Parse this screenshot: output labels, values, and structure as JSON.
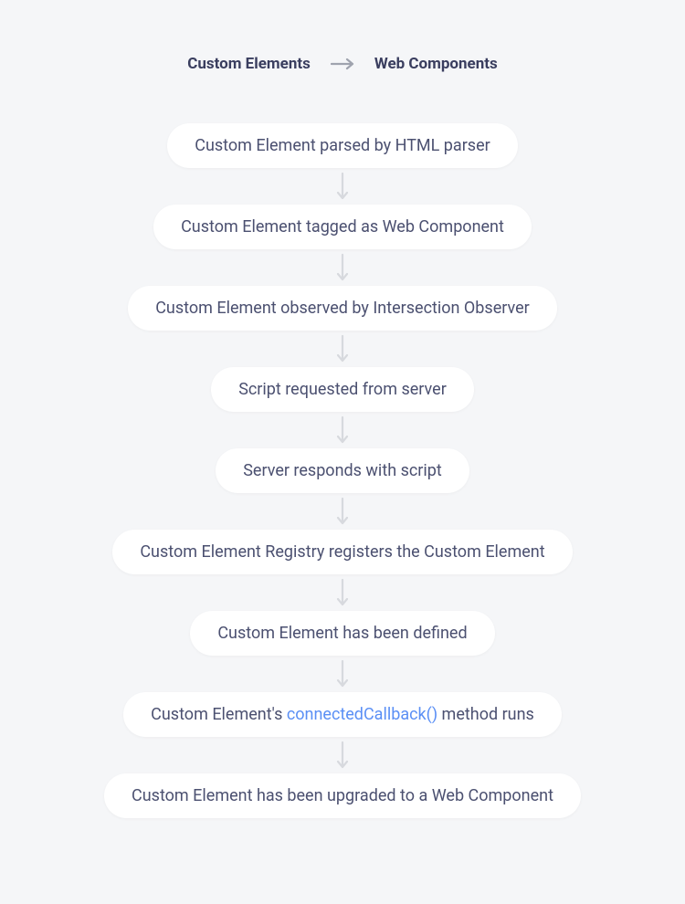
{
  "header": {
    "left_label": "Custom Elements",
    "right_label": "Web Components"
  },
  "steps": [
    {
      "text": "Custom Element parsed by HTML parser"
    },
    {
      "text": "Custom Element tagged as Web Component"
    },
    {
      "text": "Custom Element observed by Intersection Observer"
    },
    {
      "text": "Script requested from server"
    },
    {
      "text": "Server responds with script"
    },
    {
      "text": "Custom Element Registry registers the Custom Element"
    },
    {
      "text": "Custom Element has been defined"
    },
    {
      "text_before": "Custom Element's ",
      "highlight": "connectedCallback()",
      "text_after": " method runs"
    },
    {
      "text": "Custom Element has been upgraded to a Web Component"
    }
  ],
  "colors": {
    "background": "#f5f6f8",
    "text": "#4b5070",
    "header_text": "#3a3e5f",
    "highlight": "#5a8ff5",
    "arrow": "#d7d9de"
  }
}
